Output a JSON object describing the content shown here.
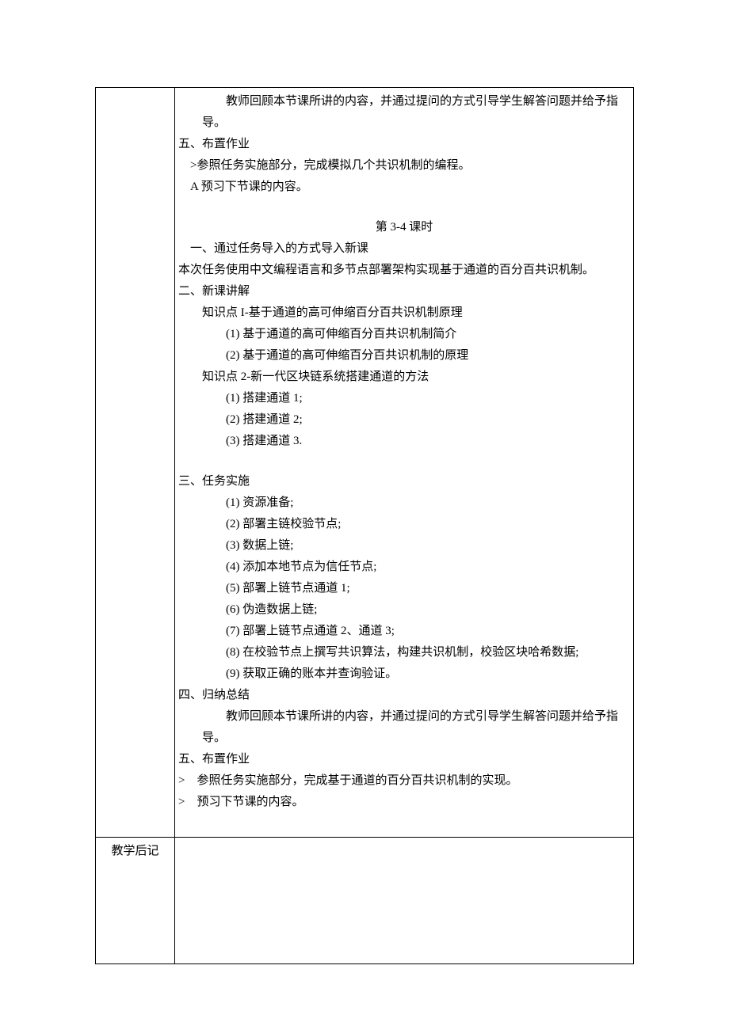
{
  "row1": {
    "p1": "教师回顾本节课所讲的内容，并通过提问的方式引导学生解答问题并给予指导。",
    "h5": "五、布置作业",
    "h5_1": ">参照任务实施部分，完成模拟几个共识机制的编程。",
    "h5_2": "A 预习下节课的内容。",
    "period": "第 3-4 课时",
    "s1": "一、通过任务导入的方式导入新课",
    "s1_body": "本次任务使用中文编程语言和多节点部署架构实现基于通道的百分百共识机制。",
    "s2": "二、新课讲解",
    "s2_k1": "知识点 I-基于通道的高可伸缩百分百共识机制原理",
    "s2_k1_1": "(1) 基于通道的高可伸缩百分百共识机制简介",
    "s2_k1_2": "(2) 基于通道的高可伸缩百分百共识机制的原理",
    "s2_k2": "知识点 2-新一代区块链系统搭建通道的方法",
    "s2_k2_1": "(1) 搭建通道 1;",
    "s2_k2_2": "(2) 搭建通道 2;",
    "s2_k2_3": "(3) 搭建通道 3.",
    "s3": "三、任务实施",
    "s3_1": "(1) 资源准备;",
    "s3_2": "(2) 部署主链校验节点;",
    "s3_3": "(3) 数据上链;",
    "s3_4": "(4) 添加本地节点为信任节点;",
    "s3_5": "(5) 部署上链节点通道 1;",
    "s3_6": "(6) 伪造数据上链;",
    "s3_7": "(7) 部署上链节点通道 2、通道 3;",
    "s3_8": "(8) 在校验节点上撰写共识算法，构建共识机制，校验区块哈希数据;",
    "s3_9": "(9) 获取正确的账本并查询验证。",
    "s4": "四、归纳总结",
    "s4_body": "教师回顾本节课所讲的内容，并通过提问的方式引导学生解答问题并给予指导。",
    "s5": "五、布置作业",
    "s5_1": "参照任务实施部分，完成基于通道的百分百共识机制的实现。",
    "s5_2": "预习下节课的内容。",
    "gt": ">"
  },
  "row2": {
    "label": "教学后记"
  }
}
